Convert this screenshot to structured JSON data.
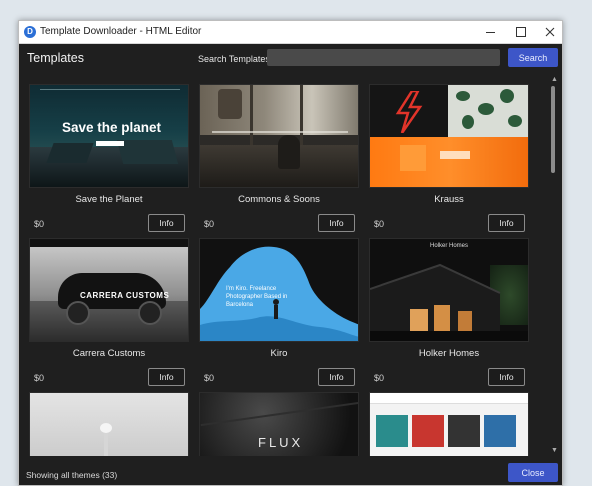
{
  "window": {
    "title": "Template Downloader - HTML Editor",
    "app_icon_letter": "D"
  },
  "header": {
    "heading": "Templates",
    "search_label": "Search Templates",
    "search_value": "",
    "search_button": "Search"
  },
  "templates": [
    {
      "name": "Save the Planet",
      "price": "$0",
      "info": "Info",
      "thumb_text": "Save the planet"
    },
    {
      "name": "Commons & Soons",
      "price": "$0",
      "info": "Info"
    },
    {
      "name": "Krauss",
      "price": "$0",
      "info": "Info"
    },
    {
      "name": "Carrera Customs",
      "price": "$0",
      "info": "Info",
      "thumb_text": "CARRERA CUSTOMS"
    },
    {
      "name": "Kiro",
      "price": "$0",
      "info": "Info",
      "thumb_text": "I'm Kiro. Freelance Photographer Based in Barcelona"
    },
    {
      "name": "Holker Homes",
      "price": "$0",
      "info": "Info",
      "thumb_text": "Holker Homes"
    },
    {
      "name": "",
      "price": "",
      "info": ""
    },
    {
      "name": "",
      "price": "",
      "info": "",
      "thumb_text": "FLUX"
    },
    {
      "name": "",
      "price": "",
      "info": ""
    }
  ],
  "footer": {
    "status": "Showing all themes (33)",
    "close_button": "Close"
  },
  "colors": {
    "accent": "#3d56c8",
    "background": "#1f1f1f"
  }
}
